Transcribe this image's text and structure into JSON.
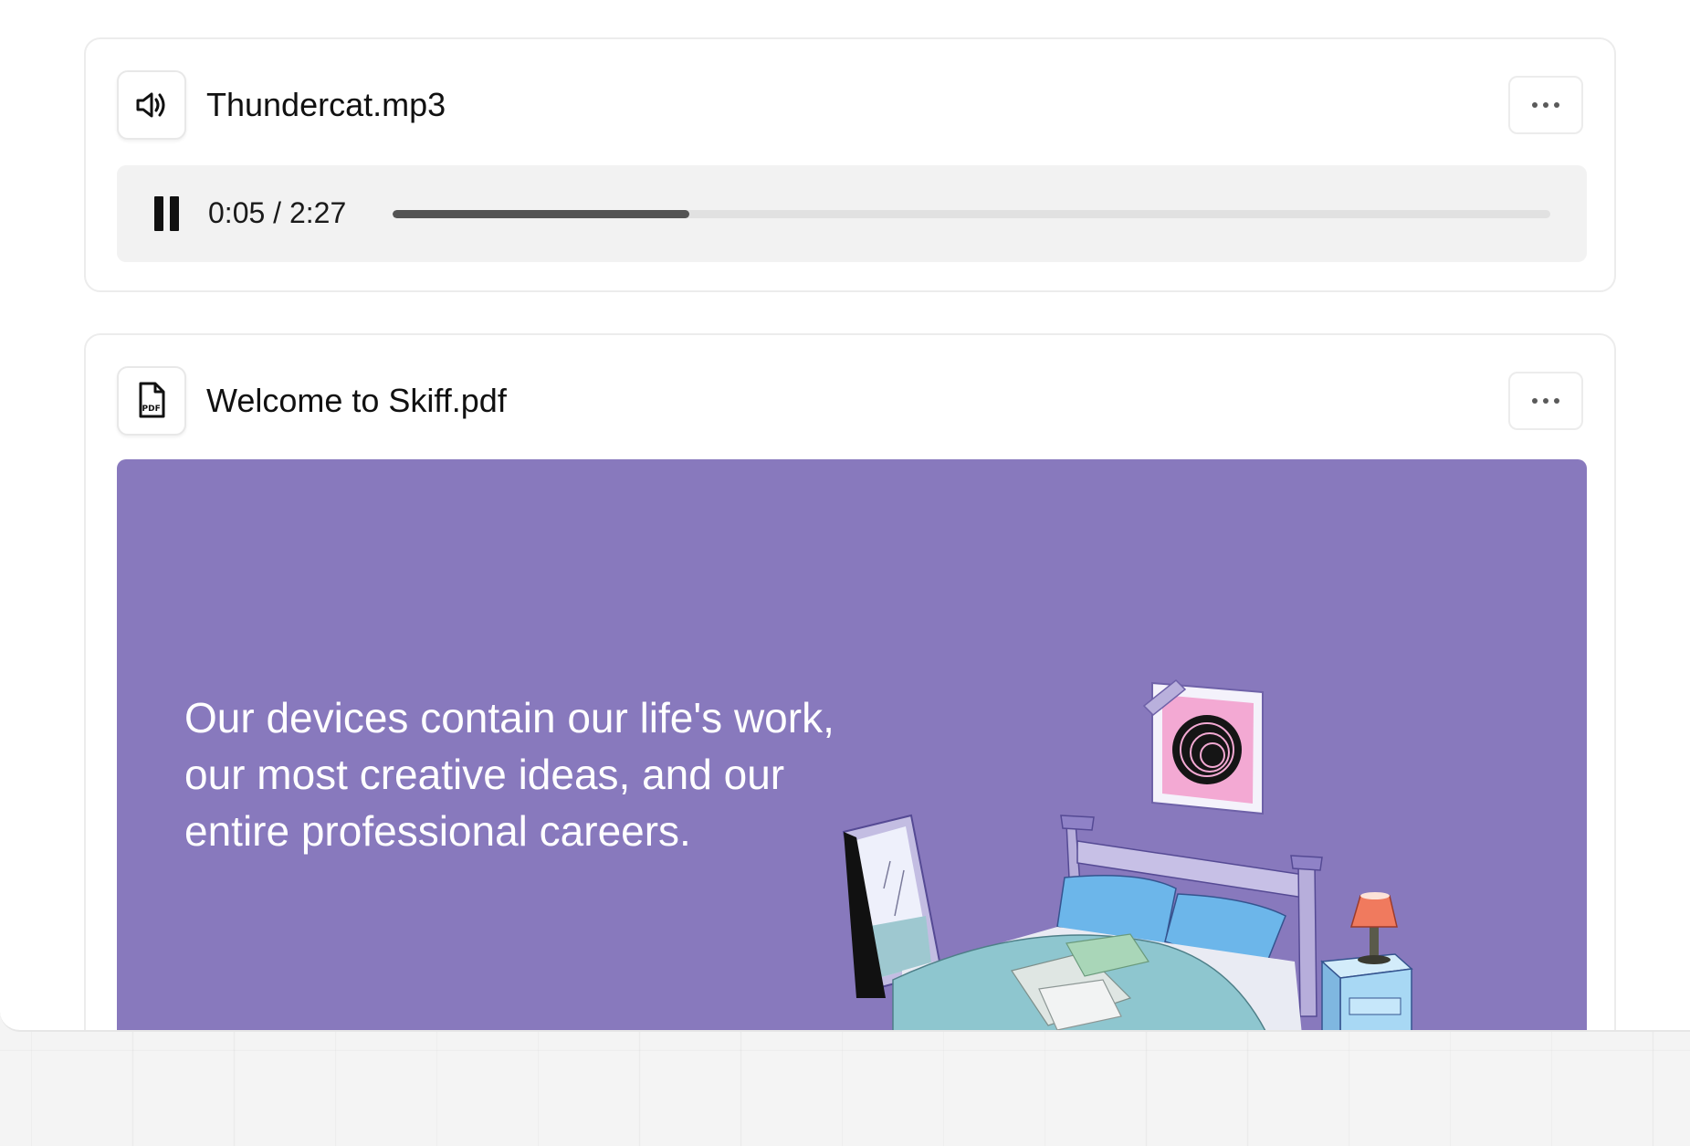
{
  "audio_attachment": {
    "file_name": "Thundercat.mp3",
    "icon": "speaker-icon",
    "player": {
      "state": "playing",
      "control_icon": "pause-icon",
      "current_time": "0:05",
      "duration": "2:27",
      "time_display": "0:05 / 2:27",
      "progress_fraction": 0.256
    }
  },
  "pdf_attachment": {
    "file_name": "Welcome to Skiff.pdf",
    "icon": "pdf-file-icon",
    "preview": {
      "text": "Our devices contain our life's work, our most creative ideas, and our entire professional careers.",
      "illustration": "bedroom-illustration",
      "background_color": "#8879bd"
    }
  },
  "more_options_icon": "more-horizontal-icon",
  "colors": {
    "page_background": "#f4f4f4",
    "card_background": "#ffffff",
    "player_background": "#f2f2f2",
    "progress_fill": "#545454",
    "progress_track": "#e1e1e1",
    "preview_purple": "#8879bd"
  }
}
